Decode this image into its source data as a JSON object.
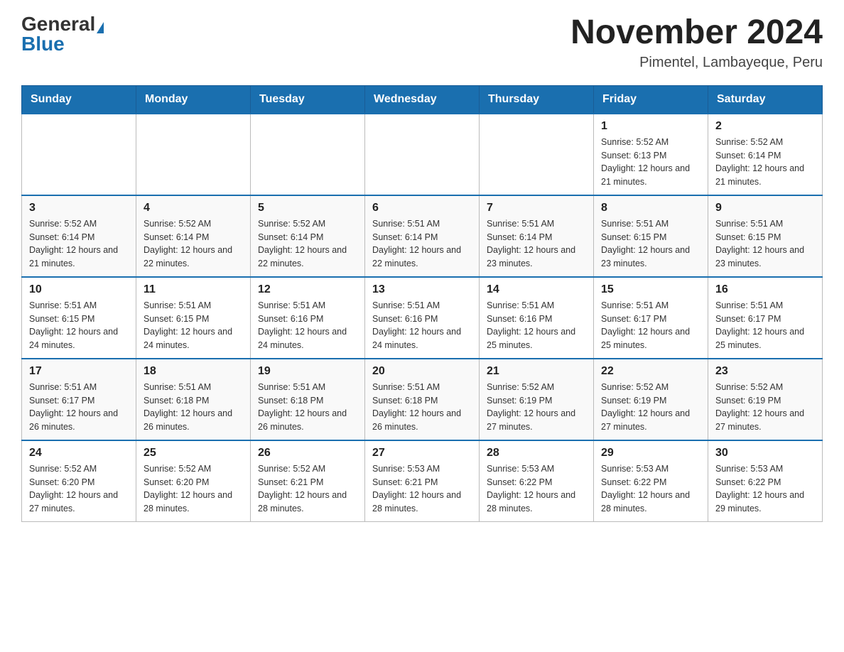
{
  "header": {
    "logo_general": "General",
    "logo_blue": "Blue",
    "month_title": "November 2024",
    "location": "Pimentel, Lambayeque, Peru"
  },
  "weekdays": [
    "Sunday",
    "Monday",
    "Tuesday",
    "Wednesday",
    "Thursday",
    "Friday",
    "Saturday"
  ],
  "weeks": [
    [
      {
        "day": "",
        "sunrise": "",
        "sunset": "",
        "daylight": ""
      },
      {
        "day": "",
        "sunrise": "",
        "sunset": "",
        "daylight": ""
      },
      {
        "day": "",
        "sunrise": "",
        "sunset": "",
        "daylight": ""
      },
      {
        "day": "",
        "sunrise": "",
        "sunset": "",
        "daylight": ""
      },
      {
        "day": "",
        "sunrise": "",
        "sunset": "",
        "daylight": ""
      },
      {
        "day": "1",
        "sunrise": "Sunrise: 5:52 AM",
        "sunset": "Sunset: 6:13 PM",
        "daylight": "Daylight: 12 hours and 21 minutes."
      },
      {
        "day": "2",
        "sunrise": "Sunrise: 5:52 AM",
        "sunset": "Sunset: 6:14 PM",
        "daylight": "Daylight: 12 hours and 21 minutes."
      }
    ],
    [
      {
        "day": "3",
        "sunrise": "Sunrise: 5:52 AM",
        "sunset": "Sunset: 6:14 PM",
        "daylight": "Daylight: 12 hours and 21 minutes."
      },
      {
        "day": "4",
        "sunrise": "Sunrise: 5:52 AM",
        "sunset": "Sunset: 6:14 PM",
        "daylight": "Daylight: 12 hours and 22 minutes."
      },
      {
        "day": "5",
        "sunrise": "Sunrise: 5:52 AM",
        "sunset": "Sunset: 6:14 PM",
        "daylight": "Daylight: 12 hours and 22 minutes."
      },
      {
        "day": "6",
        "sunrise": "Sunrise: 5:51 AM",
        "sunset": "Sunset: 6:14 PM",
        "daylight": "Daylight: 12 hours and 22 minutes."
      },
      {
        "day": "7",
        "sunrise": "Sunrise: 5:51 AM",
        "sunset": "Sunset: 6:14 PM",
        "daylight": "Daylight: 12 hours and 23 minutes."
      },
      {
        "day": "8",
        "sunrise": "Sunrise: 5:51 AM",
        "sunset": "Sunset: 6:15 PM",
        "daylight": "Daylight: 12 hours and 23 minutes."
      },
      {
        "day": "9",
        "sunrise": "Sunrise: 5:51 AM",
        "sunset": "Sunset: 6:15 PM",
        "daylight": "Daylight: 12 hours and 23 minutes."
      }
    ],
    [
      {
        "day": "10",
        "sunrise": "Sunrise: 5:51 AM",
        "sunset": "Sunset: 6:15 PM",
        "daylight": "Daylight: 12 hours and 24 minutes."
      },
      {
        "day": "11",
        "sunrise": "Sunrise: 5:51 AM",
        "sunset": "Sunset: 6:15 PM",
        "daylight": "Daylight: 12 hours and 24 minutes."
      },
      {
        "day": "12",
        "sunrise": "Sunrise: 5:51 AM",
        "sunset": "Sunset: 6:16 PM",
        "daylight": "Daylight: 12 hours and 24 minutes."
      },
      {
        "day": "13",
        "sunrise": "Sunrise: 5:51 AM",
        "sunset": "Sunset: 6:16 PM",
        "daylight": "Daylight: 12 hours and 24 minutes."
      },
      {
        "day": "14",
        "sunrise": "Sunrise: 5:51 AM",
        "sunset": "Sunset: 6:16 PM",
        "daylight": "Daylight: 12 hours and 25 minutes."
      },
      {
        "day": "15",
        "sunrise": "Sunrise: 5:51 AM",
        "sunset": "Sunset: 6:17 PM",
        "daylight": "Daylight: 12 hours and 25 minutes."
      },
      {
        "day": "16",
        "sunrise": "Sunrise: 5:51 AM",
        "sunset": "Sunset: 6:17 PM",
        "daylight": "Daylight: 12 hours and 25 minutes."
      }
    ],
    [
      {
        "day": "17",
        "sunrise": "Sunrise: 5:51 AM",
        "sunset": "Sunset: 6:17 PM",
        "daylight": "Daylight: 12 hours and 26 minutes."
      },
      {
        "day": "18",
        "sunrise": "Sunrise: 5:51 AM",
        "sunset": "Sunset: 6:18 PM",
        "daylight": "Daylight: 12 hours and 26 minutes."
      },
      {
        "day": "19",
        "sunrise": "Sunrise: 5:51 AM",
        "sunset": "Sunset: 6:18 PM",
        "daylight": "Daylight: 12 hours and 26 minutes."
      },
      {
        "day": "20",
        "sunrise": "Sunrise: 5:51 AM",
        "sunset": "Sunset: 6:18 PM",
        "daylight": "Daylight: 12 hours and 26 minutes."
      },
      {
        "day": "21",
        "sunrise": "Sunrise: 5:52 AM",
        "sunset": "Sunset: 6:19 PM",
        "daylight": "Daylight: 12 hours and 27 minutes."
      },
      {
        "day": "22",
        "sunrise": "Sunrise: 5:52 AM",
        "sunset": "Sunset: 6:19 PM",
        "daylight": "Daylight: 12 hours and 27 minutes."
      },
      {
        "day": "23",
        "sunrise": "Sunrise: 5:52 AM",
        "sunset": "Sunset: 6:19 PM",
        "daylight": "Daylight: 12 hours and 27 minutes."
      }
    ],
    [
      {
        "day": "24",
        "sunrise": "Sunrise: 5:52 AM",
        "sunset": "Sunset: 6:20 PM",
        "daylight": "Daylight: 12 hours and 27 minutes."
      },
      {
        "day": "25",
        "sunrise": "Sunrise: 5:52 AM",
        "sunset": "Sunset: 6:20 PM",
        "daylight": "Daylight: 12 hours and 28 minutes."
      },
      {
        "day": "26",
        "sunrise": "Sunrise: 5:52 AM",
        "sunset": "Sunset: 6:21 PM",
        "daylight": "Daylight: 12 hours and 28 minutes."
      },
      {
        "day": "27",
        "sunrise": "Sunrise: 5:53 AM",
        "sunset": "Sunset: 6:21 PM",
        "daylight": "Daylight: 12 hours and 28 minutes."
      },
      {
        "day": "28",
        "sunrise": "Sunrise: 5:53 AM",
        "sunset": "Sunset: 6:22 PM",
        "daylight": "Daylight: 12 hours and 28 minutes."
      },
      {
        "day": "29",
        "sunrise": "Sunrise: 5:53 AM",
        "sunset": "Sunset: 6:22 PM",
        "daylight": "Daylight: 12 hours and 28 minutes."
      },
      {
        "day": "30",
        "sunrise": "Sunrise: 5:53 AM",
        "sunset": "Sunset: 6:22 PM",
        "daylight": "Daylight: 12 hours and 29 minutes."
      }
    ]
  ]
}
